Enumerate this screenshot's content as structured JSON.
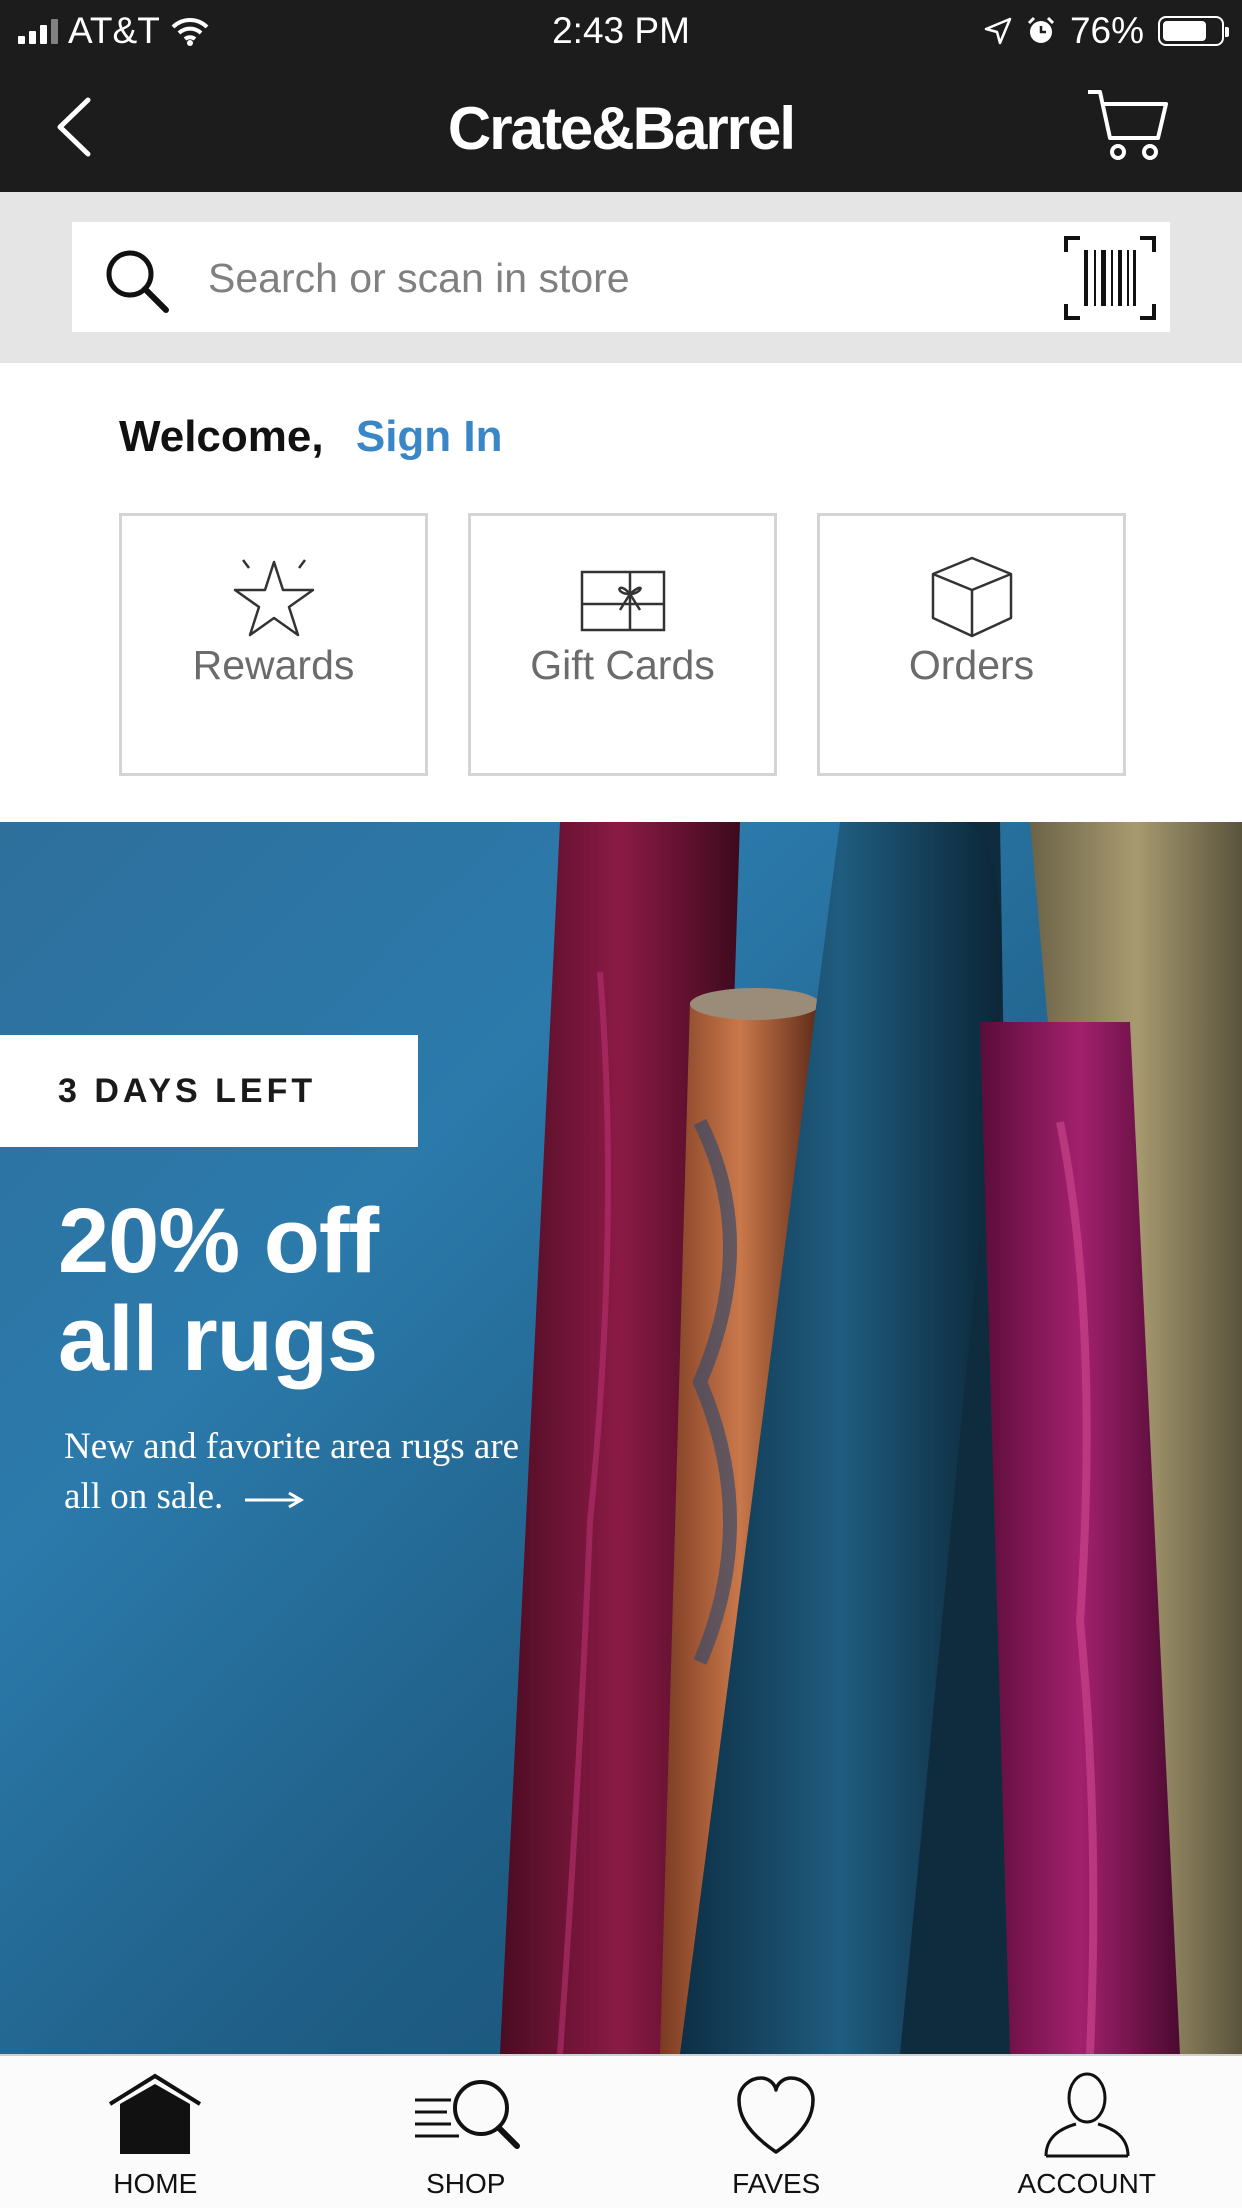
{
  "status_bar": {
    "carrier": "AT&T",
    "time": "2:43 PM",
    "battery": "76%",
    "battery_level": 0.76
  },
  "nav": {
    "brand": "Crate&Barrel",
    "icons": [
      "back-icon",
      "cart-icon"
    ]
  },
  "search": {
    "placeholder": "Search or scan in store",
    "icons": [
      "search-icon",
      "barcode-icon"
    ]
  },
  "welcome": {
    "label": "Welcome,",
    "sign_in": "Sign In"
  },
  "tiles": [
    {
      "label": "Rewards",
      "icon": "star-icon"
    },
    {
      "label": "Gift Cards",
      "icon": "gift-card-icon"
    },
    {
      "label": "Orders",
      "icon": "box-icon"
    }
  ],
  "promo": {
    "badge": "3 DAYS LEFT",
    "headline": "20% off\nall rugs",
    "subtext": "New and favorite area rugs are all on sale."
  },
  "tabs": [
    {
      "label": "HOME",
      "icon": "home-icon"
    },
    {
      "label": "SHOP",
      "icon": "shop-search-icon"
    },
    {
      "label": "FAVES",
      "icon": "heart-icon"
    },
    {
      "label": "ACCOUNT",
      "icon": "person-icon"
    }
  ],
  "colors": {
    "header_bg": "#1c1c1c",
    "link": "#3a87c8",
    "search_band": "#e5e5e5"
  }
}
